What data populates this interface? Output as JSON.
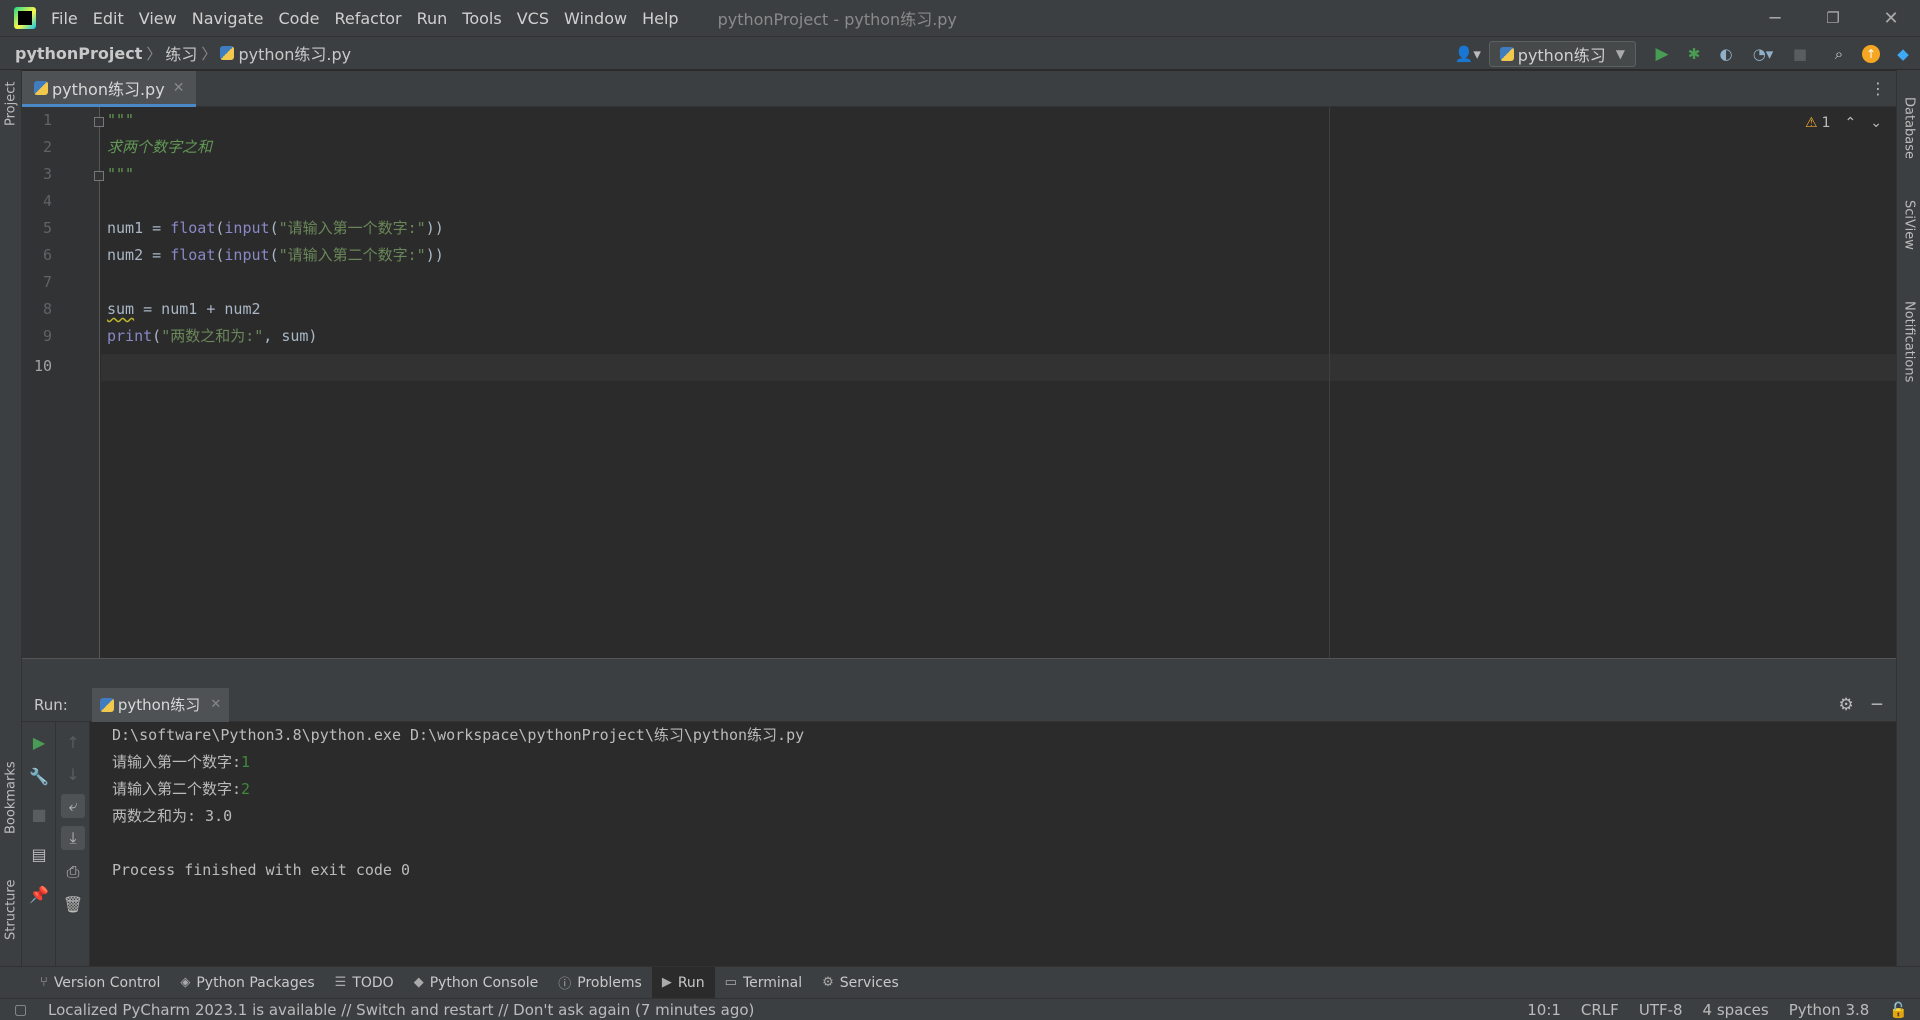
{
  "menu": [
    "File",
    "Edit",
    "View",
    "Navigate",
    "Code",
    "Refactor",
    "Run",
    "Tools",
    "VCS",
    "Window",
    "Help"
  ],
  "window_title": "pythonProject - python练习.py",
  "window_controls": {
    "minimize": "─",
    "restore": "❐",
    "close": "✕"
  },
  "breadcrumb": {
    "project": "pythonProject",
    "folder": "练习",
    "file": "python练习.py"
  },
  "run_config": {
    "label": "python练习"
  },
  "editor": {
    "tab_label": "python练习.py",
    "line_numbers": [
      "1",
      "2",
      "3",
      "4",
      "5",
      "6",
      "7",
      "8",
      "9",
      "10"
    ],
    "inspection_count": "1",
    "code": {
      "l1": "\"\"\"",
      "l2": "求两个数字之和",
      "l3": "\"\"\"",
      "l5_a": "num1 = ",
      "l5_fn": "float",
      "l5_b": "(",
      "l5_in": "input",
      "l5_c": "(",
      "l5_str": "\"请输入第一个数字:\"",
      "l5_d": "))",
      "l6_a": "num2 = ",
      "l6_fn": "float",
      "l6_b": "(",
      "l6_in": "input",
      "l6_c": "(",
      "l6_str": "\"请输入第二个数字:\"",
      "l6_d": "))",
      "l8_var": "sum",
      "l8_rest": " = num1 + num2",
      "l9_fn": "print",
      "l9_a": "(",
      "l9_str": "\"两数之和为:\"",
      "l9_b": ", sum)"
    }
  },
  "run_panel": {
    "label": "Run:",
    "tab_label": "python练习",
    "console": {
      "cmd": "D:\\software\\Python3.8\\python.exe D:\\workspace\\pythonProject\\练习\\python练习.py",
      "prompt1": "请输入第一个数字:",
      "input1": "1",
      "prompt2": "请输入第二个数字:",
      "input2": "2",
      "result": "两数之和为: 3.0",
      "exit": "Process finished with exit code 0"
    }
  },
  "side_tabs": {
    "project": "Project",
    "bookmarks": "Bookmarks",
    "structure": "Structure",
    "database": "Database",
    "sciview": "SciView",
    "notifications": "Notifications"
  },
  "bottom_tabs": [
    "Version Control",
    "Python Packages",
    "TODO",
    "Python Console",
    "Problems",
    "Run",
    "Terminal",
    "Services"
  ],
  "status": {
    "message": "Localized PyCharm 2023.1 is available // Switch and restart // Don't ask again (7 minutes ago)",
    "position": "10:1",
    "line_sep": "CRLF",
    "encoding": "UTF-8",
    "indent": "4 spaces",
    "interpreter": "Python 3.8"
  },
  "colors": {
    "accent": "#4a88c7",
    "run_green": "#499c54",
    "warning": "#f0a732",
    "update_badge": "#f5a623"
  }
}
